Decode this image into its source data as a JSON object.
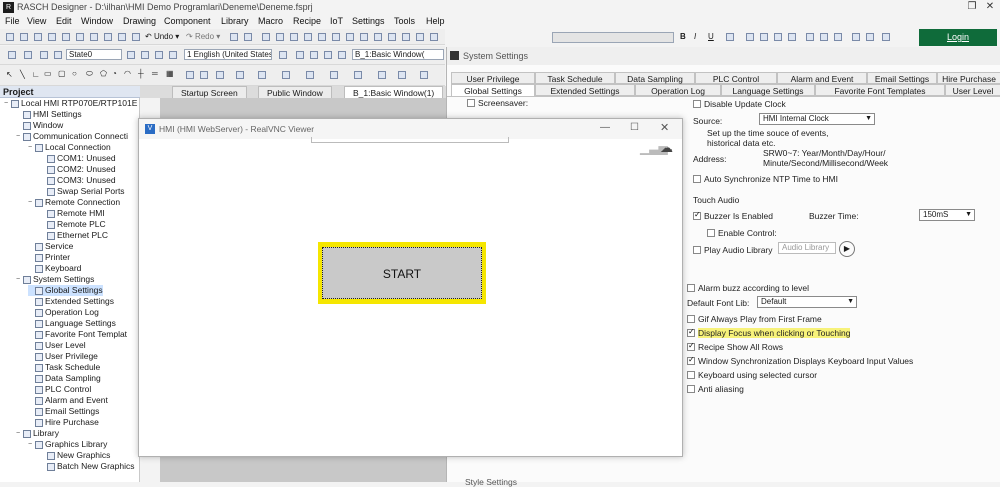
{
  "app": {
    "title": "RASCH Designer - D:\\ilhan\\HMI Demo Programlari\\Deneme\\Deneme.fsprj",
    "logo": "R"
  },
  "menu": [
    "File",
    "View",
    "Edit",
    "Window",
    "Drawing",
    "Component",
    "Library",
    "Macro",
    "Recipe",
    "IoT",
    "Settings",
    "Tools",
    "Help"
  ],
  "toolbar": {
    "state_combo": "State0",
    "undo": "Undo",
    "redo": "Redo",
    "language_combo": "1 English (United States",
    "window_combo": "B_1:Basic Window(",
    "login": "Login",
    "format_b": "B",
    "format_i": "I",
    "format_u": "U"
  },
  "project": {
    "header": "Project",
    "tree": [
      {
        "label": "Local HMI RTP070E/RTP101E",
        "level": 0,
        "exp": "-"
      },
      {
        "label": "HMI Settings",
        "level": 1,
        "exp": ""
      },
      {
        "label": "Window",
        "level": 1,
        "exp": ""
      },
      {
        "label": "Communication Connecti",
        "level": 1,
        "exp": "-"
      },
      {
        "label": "Local Connection",
        "level": 2,
        "exp": "-"
      },
      {
        "label": "COM1: Unused",
        "level": 3,
        "exp": ""
      },
      {
        "label": "COM2: Unused",
        "level": 3,
        "exp": ""
      },
      {
        "label": "COM3: Unused",
        "level": 3,
        "exp": ""
      },
      {
        "label": "Swap Serial Ports",
        "level": 3,
        "exp": ""
      },
      {
        "label": "Remote Connection",
        "level": 2,
        "exp": "-"
      },
      {
        "label": "Remote HMI",
        "level": 3,
        "exp": ""
      },
      {
        "label": "Remote PLC",
        "level": 3,
        "exp": ""
      },
      {
        "label": "Ethernet PLC",
        "level": 3,
        "exp": ""
      },
      {
        "label": "Service",
        "level": 2,
        "exp": ""
      },
      {
        "label": "Printer",
        "level": 2,
        "exp": ""
      },
      {
        "label": "Keyboard",
        "level": 2,
        "exp": ""
      },
      {
        "label": "System Settings",
        "level": 1,
        "exp": "-"
      },
      {
        "label": "Global Settings",
        "level": 2,
        "exp": "",
        "selected": true
      },
      {
        "label": "Extended Settings",
        "level": 2,
        "exp": ""
      },
      {
        "label": "Operation Log",
        "level": 2,
        "exp": ""
      },
      {
        "label": "Language Settings",
        "level": 2,
        "exp": ""
      },
      {
        "label": "Favorite Font Templat",
        "level": 2,
        "exp": ""
      },
      {
        "label": "User Level",
        "level": 2,
        "exp": ""
      },
      {
        "label": "User Privilege",
        "level": 2,
        "exp": ""
      },
      {
        "label": "Task Schedule",
        "level": 2,
        "exp": ""
      },
      {
        "label": "Data Sampling",
        "level": 2,
        "exp": ""
      },
      {
        "label": "PLC Control",
        "level": 2,
        "exp": ""
      },
      {
        "label": "Alarm and Event",
        "level": 2,
        "exp": ""
      },
      {
        "label": "Email Settings",
        "level": 2,
        "exp": ""
      },
      {
        "label": "Hire Purchase",
        "level": 2,
        "exp": ""
      },
      {
        "label": "Library",
        "level": 1,
        "exp": "-"
      },
      {
        "label": "Graphics Library",
        "level": 2,
        "exp": "-"
      },
      {
        "label": "New Graphics",
        "level": 3,
        "exp": ""
      },
      {
        "label": "Batch New Graphics",
        "level": 3,
        "exp": ""
      }
    ]
  },
  "editor": {
    "tabs": [
      "Startup Screen",
      "Public Window",
      "B_1:Basic Window(1)"
    ]
  },
  "system_settings": {
    "title": "System Settings",
    "tabs_row1": [
      "User Privilege",
      "Task Schedule",
      "Data Sampling",
      "PLC Control",
      "Alarm and Event",
      "Email Settings",
      "Hire Purchase"
    ],
    "tabs_row2": [
      "Global Settings",
      "Extended Settings",
      "Operation Log",
      "Language Settings",
      "Favorite Font Templates",
      "User Level"
    ],
    "screensaver": "Screensaver:",
    "disable_update_clock": "Disable Update Clock",
    "source_label": "Source:",
    "source_value": "HMI Internal Clock",
    "source_desc": "Set up the time souce of events, historical data etc.",
    "address_label": "Address:",
    "address_value": "SRW0~7: Year/Month/Day/Hour/ Minute/Second/Millisecond/Week",
    "auto_sync": "Auto Synchronize NTP Time to HMI",
    "touch_audio": "Touch Audio",
    "buzzer_enabled": "Buzzer Is Enabled",
    "buzzer_time_label": "Buzzer Time:",
    "buzzer_time_value": "150mS",
    "enable_control": "Enable Control:",
    "play_audio": "Play Audio Library",
    "audio_library": "Audio Library",
    "alarm_buzz": "Alarm buzz according to level",
    "default_font_label": "Default Font Lib:",
    "default_font_value": "Default",
    "gif_always": "Gif Always Play from First Frame",
    "display_focus": "Display Focus when clicking or Touching",
    "recipe_show": "Recipe Show All Rows",
    "window_sync": "Window Synchronization Displays Keyboard Input Values",
    "keyboard_cursor": "Keyboard using selected cursor",
    "anti_aliasing": "Anti aliasing",
    "style_settings": "Style Settings"
  },
  "vnc": {
    "title": "HMI (HMI WebServer) - RealVNC Viewer",
    "start_label": "START"
  }
}
